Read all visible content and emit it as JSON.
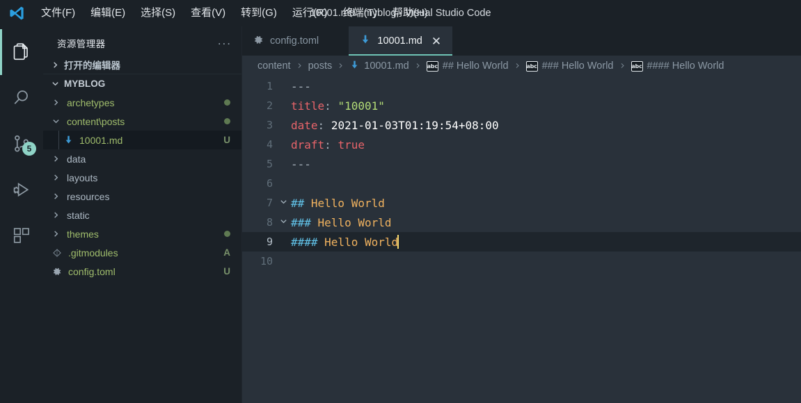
{
  "window": {
    "title": "10001.md - myblog - Visual Studio Code",
    "logo_icon": "vscode-logo"
  },
  "menubar": {
    "items": [
      {
        "label": "文件(F)",
        "mnemonic": "F",
        "name": "menu-file"
      },
      {
        "label": "编辑(E)",
        "mnemonic": "E",
        "name": "menu-edit"
      },
      {
        "label": "选择(S)",
        "mnemonic": "S",
        "name": "menu-selection"
      },
      {
        "label": "查看(V)",
        "mnemonic": "V",
        "name": "menu-view"
      },
      {
        "label": "转到(G)",
        "mnemonic": "G",
        "name": "menu-go"
      },
      {
        "label": "运行(R)",
        "mnemonic": "R",
        "name": "menu-run"
      },
      {
        "label": "终端(T)",
        "mnemonic": "T",
        "name": "menu-terminal"
      },
      {
        "label": "帮助(H)",
        "mnemonic": "H",
        "name": "menu-help"
      }
    ]
  },
  "activitybar": {
    "items": [
      {
        "icon": "files-explorer-icon",
        "name": "activity-explorer",
        "active": true,
        "badge": ""
      },
      {
        "icon": "search-icon",
        "name": "activity-search",
        "active": false,
        "badge": ""
      },
      {
        "icon": "source-control-icon",
        "name": "activity-source-control",
        "active": false,
        "badge": "5"
      },
      {
        "icon": "run-debug-icon",
        "name": "activity-run-debug",
        "active": false,
        "badge": ""
      },
      {
        "icon": "extensions-icon",
        "name": "activity-extensions",
        "active": false,
        "badge": ""
      }
    ],
    "badge_color": "#8fd3c6",
    "accent_color": "#8fd3c6"
  },
  "sidebar": {
    "title": "资源管理器",
    "more_actions": "...",
    "opened_editors_label": "打开的编辑器",
    "root_label": "MYBLOG",
    "tree": [
      {
        "label": "archetypes",
        "type": "folder",
        "expanded": false,
        "depth": 1,
        "deco": "dot",
        "modified": true,
        "selected": false
      },
      {
        "label": "content\\posts",
        "type": "folder",
        "expanded": true,
        "depth": 1,
        "deco": "dot",
        "modified": true,
        "selected": false
      },
      {
        "label": "10001.md",
        "type": "markdown",
        "expanded": null,
        "depth": 2,
        "deco": "U",
        "modified": true,
        "selected": true
      },
      {
        "label": "data",
        "type": "folder",
        "expanded": false,
        "depth": 1,
        "deco": "",
        "modified": false,
        "selected": false
      },
      {
        "label": "layouts",
        "type": "folder",
        "expanded": false,
        "depth": 1,
        "deco": "",
        "modified": false,
        "selected": false
      },
      {
        "label": "resources",
        "type": "folder",
        "expanded": false,
        "depth": 1,
        "deco": "",
        "modified": false,
        "selected": false
      },
      {
        "label": "static",
        "type": "folder",
        "expanded": false,
        "depth": 1,
        "deco": "",
        "modified": false,
        "selected": false
      },
      {
        "label": "themes",
        "type": "folder",
        "expanded": false,
        "depth": 1,
        "deco": "dot",
        "modified": true,
        "selected": false
      },
      {
        "label": ".gitmodules",
        "type": "git",
        "expanded": null,
        "depth": 1,
        "deco": "A",
        "modified": true,
        "selected": false
      },
      {
        "label": "config.toml",
        "type": "gear",
        "expanded": null,
        "depth": 1,
        "deco": "U",
        "modified": true,
        "selected": false
      }
    ]
  },
  "tabs": [
    {
      "label": "config.toml",
      "icon": "gear-icon",
      "active": false,
      "name": "tab-config-toml"
    },
    {
      "label": "10001.md",
      "icon": "markdown-icon",
      "active": true,
      "name": "tab-10001-md"
    }
  ],
  "tab_close_glyph": "✕",
  "breadcrumbs": [
    {
      "label": "content",
      "icon": ""
    },
    {
      "label": "posts",
      "icon": ""
    },
    {
      "label": "10001.md",
      "icon": "markdown-icon"
    },
    {
      "label": "## Hello World",
      "icon": "symbol-string-icon"
    },
    {
      "label": "### Hello World",
      "icon": "symbol-string-icon"
    },
    {
      "label": "#### Hello World",
      "icon": "symbol-string-icon"
    }
  ],
  "breadcrumb_separator": "❯",
  "symbol_icon_text": "abc",
  "editor": {
    "active_line": 9,
    "cursor_line": 9,
    "lines": [
      {
        "n": 1,
        "fold": "",
        "tokens": [
          {
            "t": "---",
            "c": "tok-dash"
          }
        ]
      },
      {
        "n": 2,
        "fold": "",
        "tokens": [
          {
            "t": "title",
            "c": "tok-key"
          },
          {
            "t": ":",
            "c": "tok-punct"
          },
          {
            "t": " ",
            "c": "tok-plain"
          },
          {
            "t": "\"10001\"",
            "c": "tok-str"
          }
        ]
      },
      {
        "n": 3,
        "fold": "",
        "tokens": [
          {
            "t": "date",
            "c": "tok-key"
          },
          {
            "t": ":",
            "c": "tok-punct"
          },
          {
            "t": " ",
            "c": "tok-plain"
          },
          {
            "t": "2021-01-03T01:19:54+08:00",
            "c": "tok-plain"
          }
        ]
      },
      {
        "n": 4,
        "fold": "",
        "tokens": [
          {
            "t": "draft",
            "c": "tok-key"
          },
          {
            "t": ":",
            "c": "tok-punct"
          },
          {
            "t": " ",
            "c": "tok-plain"
          },
          {
            "t": "true",
            "c": "tok-bool"
          }
        ]
      },
      {
        "n": 5,
        "fold": "",
        "tokens": [
          {
            "t": "---",
            "c": "tok-dash"
          }
        ]
      },
      {
        "n": 6,
        "fold": "",
        "tokens": []
      },
      {
        "n": 7,
        "fold": "v",
        "tokens": [
          {
            "t": "##",
            "c": "tok-hash"
          },
          {
            "t": " Hello World",
            "c": "tok-head"
          }
        ]
      },
      {
        "n": 8,
        "fold": "v",
        "tokens": [
          {
            "t": "###",
            "c": "tok-hash"
          },
          {
            "t": " Hello World",
            "c": "tok-head"
          }
        ]
      },
      {
        "n": 9,
        "fold": "",
        "tokens": [
          {
            "t": "####",
            "c": "tok-hash"
          },
          {
            "t": " Hello World",
            "c": "tok-head"
          }
        ]
      },
      {
        "n": 10,
        "fold": "",
        "tokens": []
      }
    ]
  },
  "colors": {
    "titlebar_bg": "#1b2127",
    "sidebar_bg": "#1b2127",
    "editor_bg": "#29313a",
    "active_line_bg": "#1e252c",
    "accent": "#6fc4b6",
    "cursor": "#f5d76e",
    "heading": "#f0b25f",
    "hash": "#61c2e8",
    "key": "#e8646a",
    "string": "#b4dd77",
    "git_modified": "#a0bd6c"
  }
}
